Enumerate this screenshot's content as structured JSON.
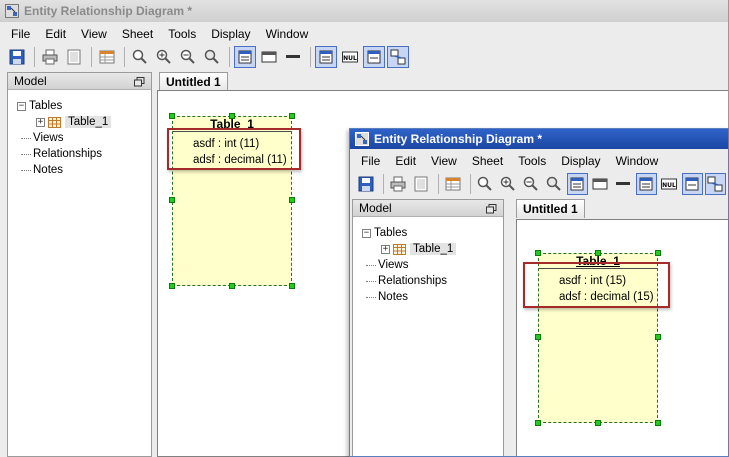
{
  "back_window": {
    "title": "Entity Relationship Diagram *",
    "menu": [
      "File",
      "Edit",
      "View",
      "Sheet",
      "Tools",
      "Display",
      "Window"
    ],
    "model_panel": {
      "header": "Model",
      "tree": {
        "tables": "Tables",
        "table_item": "Table_1",
        "views": "Views",
        "relationships": "Relationships",
        "notes": "Notes"
      }
    },
    "tab": "Untitled 1",
    "entity": {
      "title": "Table_1",
      "attributes": [
        "asdf : int (11)",
        "adsf : decimal (11)"
      ]
    }
  },
  "front_window": {
    "title": "Entity Relationship Diagram *",
    "menu": [
      "File",
      "Edit",
      "View",
      "Sheet",
      "Tools",
      "Display",
      "Window"
    ],
    "model_panel": {
      "header": "Model",
      "tree": {
        "tables": "Tables",
        "table_item": "Table_1",
        "views": "Views",
        "relationships": "Relationships",
        "notes": "Notes"
      }
    },
    "tab": "Untitled 1",
    "entity": {
      "title": "Table_1",
      "attributes": [
        "asdf : int (15)",
        "adsf : decimal (15)"
      ]
    }
  },
  "toolbar_icons": [
    "save-icon",
    "print-icon",
    "page-setup-icon",
    "grid-icon",
    "zoom-icon",
    "zoom-in-icon",
    "zoom-out-icon",
    "zoom-fit-icon",
    "table-icon",
    "view-icon",
    "line-icon",
    "show-columns-icon",
    "null-icon",
    "detail-icon",
    "relations-icon"
  ],
  "colors": {
    "highlight_box": "#a52a2a",
    "entity_fill": "#ffffcc",
    "handle": "#22cc22",
    "active_title": "#2f63c9"
  }
}
